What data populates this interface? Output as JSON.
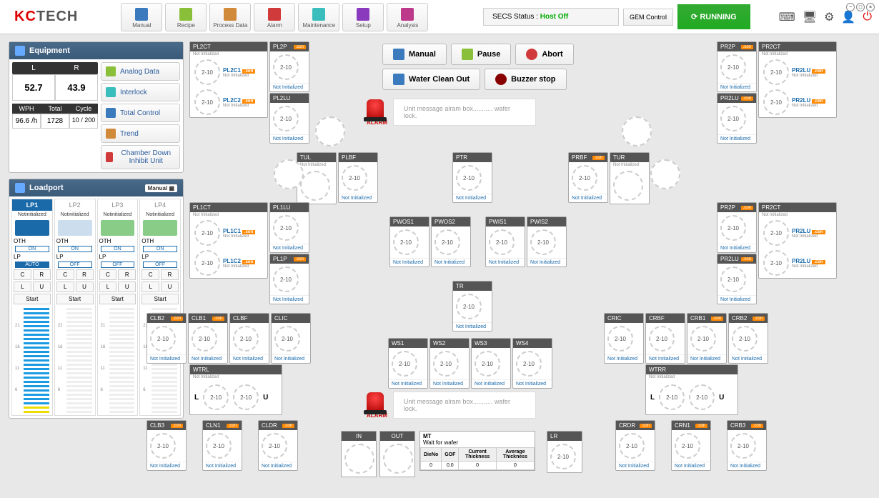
{
  "header": {
    "logo": "KCTECH",
    "toolbar": [
      {
        "label": "Manual",
        "color": "#3a7abd"
      },
      {
        "label": "Recipe",
        "color": "#8abf3a"
      },
      {
        "label": "Process Data",
        "color": "#d08a3a"
      },
      {
        "label": "Alarm",
        "color": "#d03a3a"
      },
      {
        "label": "Maintenance",
        "color": "#3abdbd"
      },
      {
        "label": "Setup",
        "color": "#8a3abd"
      },
      {
        "label": "Analysis",
        "color": "#bd3a8a"
      }
    ],
    "secs_label": "SECS Status :",
    "secs_value": "Host Off",
    "gem_label": "GEM Control",
    "running": "RUNNING"
  },
  "equipment": {
    "title": "Equipment",
    "L": "L",
    "R": "R",
    "L_val": "52.7",
    "R_val": "43.9",
    "WPH_h": "WPH",
    "Total_h": "Total",
    "Cycle_h": "Cycle",
    "WPH_v": "96.6 /h",
    "Total_v": "1728",
    "Cycle_v": "10 / 200",
    "buttons": [
      {
        "label": "Analog Data",
        "color": "#8abf3a"
      },
      {
        "label": "Interlock",
        "color": "#3abdbd"
      },
      {
        "label": "Total Control",
        "color": "#3a7abd"
      },
      {
        "label": "Trend",
        "color": "#d08a3a"
      },
      {
        "label": "Chamber Down Inhibit Unit",
        "color": "#d03a3a"
      }
    ]
  },
  "loadport": {
    "title": "Loadport",
    "manual_btn": "Manual",
    "ports": [
      {
        "name": "LP1",
        "active": true,
        "status": "Notinitialized",
        "icon": "#1a6aaa",
        "oth": "OTH",
        "oth_v": "ON",
        "lp": "LP",
        "lp_v": "AUTO",
        "lp_auto": true,
        "slots_blue": 25,
        "slots_yellow": 2
      },
      {
        "name": "LP2",
        "active": false,
        "status": "Notinitialized",
        "icon": "#cde",
        "oth": "OTH",
        "oth_v": "ON",
        "lp": "LP",
        "lp_v": "OFF",
        "lp_auto": false,
        "slots_blue": 0,
        "slots_yellow": 0
      },
      {
        "name": "LP3",
        "active": false,
        "status": "Notinitialized",
        "icon": "#8c8",
        "oth": "OTH",
        "oth_v": "ON",
        "lp": "LP",
        "lp_v": "OFF",
        "lp_auto": false,
        "slots_blue": 0,
        "slots_yellow": 0
      },
      {
        "name": "LP4",
        "active": false,
        "status": "Notinitialized",
        "icon": "#8c8",
        "oth": "OTH",
        "oth_v": "ON",
        "lp": "LP",
        "lp_v": "OFF",
        "lp_auto": false,
        "slots_blue": 0,
        "slots_yellow": 0
      }
    ],
    "btn_C": "C",
    "btn_R": "R",
    "btn_L": "L",
    "btn_U": "U",
    "btn_start": "Start",
    "slot_labels": [
      "6",
      "11",
      "16",
      "21"
    ]
  },
  "actions": {
    "manual": "Manual",
    "pause": "Pause",
    "abort": "Abort",
    "water": "Water Clean Out",
    "buzzer": "Buzzer stop"
  },
  "alarm": {
    "label": "ALARM",
    "msg": "Unit message alram box........... wafer lock."
  },
  "common": {
    "wafer_val": "2-10",
    "not_init": "Not Initialized",
    "con": ".con"
  },
  "units": {
    "PL2CT": "PL2CT",
    "PL2P": "PL2P",
    "PL2C1": "PL2C1",
    "PL2C2": "PL2C2",
    "PL2LU": "PL2LU",
    "PR2P": "PR2P",
    "PR2CT": "PR2CT",
    "PR2LU": "PR2LU",
    "TUL": "TUL",
    "PLBF": "PLBF",
    "PTR": "PTR",
    "PRBF": "PRBF",
    "TUR": "TUR",
    "PL1CT": "PL1CT",
    "PL1LU": "PL1LU",
    "PL1C1": "PL1C1",
    "PL1C2": "PL1C2",
    "PL1P": "PL1P",
    "PWOS1": "PWOS1",
    "PWOS2": "PWOS2",
    "PWIS1": "PWIS1",
    "PWIS2": "PWIS2",
    "TR": "TR",
    "CLB2": "CLB2",
    "CLB1": "CLB1",
    "CLBF": "CLBF",
    "CLIC": "CLIC",
    "WTRL": "WTRL",
    "WTRR": "WTRR",
    "L": "L",
    "U": "U",
    "WS1": "WS1",
    "WS2": "WS2",
    "WS3": "WS3",
    "WS4": "WS4",
    "CRIC": "CRIC",
    "CRBF": "CRBF",
    "CRB1": "CRB1",
    "CRB2": "CRB2",
    "CLB3": "CLB3",
    "CLN1": "CLN1",
    "CLDR": "CLDR",
    "CRDR": "CRDR",
    "CRN1": "CRN1",
    "CRB3": "CRB3",
    "IN": "IN",
    "OUT": "OUT",
    "LR": "LR",
    "MT": "MT",
    "MT_sub": "Wait for wafer"
  },
  "mt_table": {
    "headers": [
      "DieNo",
      "GOF",
      "Current Thickness",
      "Average Thickness"
    ],
    "row": [
      "0",
      "0.0",
      "0",
      "0"
    ]
  }
}
